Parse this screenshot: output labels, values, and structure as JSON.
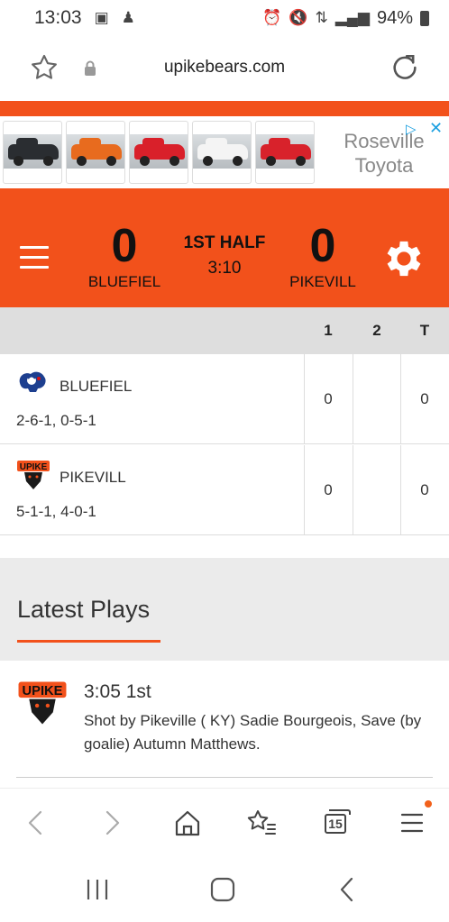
{
  "status_bar": {
    "time": "13:03",
    "battery": "94%"
  },
  "browser": {
    "url": "upikebears.com",
    "tab_count": "15"
  },
  "ad": {
    "brand_line1": "Roseville",
    "brand_line2": "Toyota",
    "car_colors": [
      "#2a2d31",
      "#e86b1e",
      "#d9202a",
      "#f4f4f4",
      "#d8222b"
    ]
  },
  "scoreboard": {
    "home_score": "0",
    "home_name": "BLUEFIEL",
    "away_score": "0",
    "away_name": "PIKEVILL",
    "period": "1ST HALF",
    "clock": "3:10"
  },
  "box_score": {
    "columns": [
      "1",
      "2",
      "T"
    ],
    "rows": [
      {
        "name": "BLUEFIEL",
        "record": "2-6-1, 0-5-1",
        "p1": "0",
        "p2": "",
        "total": "0"
      },
      {
        "name": "PIKEVILL",
        "record": "5-1-1, 4-0-1",
        "p1": "0",
        "p2": "",
        "total": "0"
      }
    ]
  },
  "latest_plays": {
    "title": "Latest Plays",
    "items": [
      {
        "time": "3:05 1st",
        "description": "Shot by Pikeville ( KY) Sadie Bourgeois, Save (by goalie) Autumn Matthews."
      }
    ]
  },
  "colors": {
    "accent": "#f2511b",
    "header_bg": "#dedede",
    "plays_bg": "#ebebeb"
  }
}
